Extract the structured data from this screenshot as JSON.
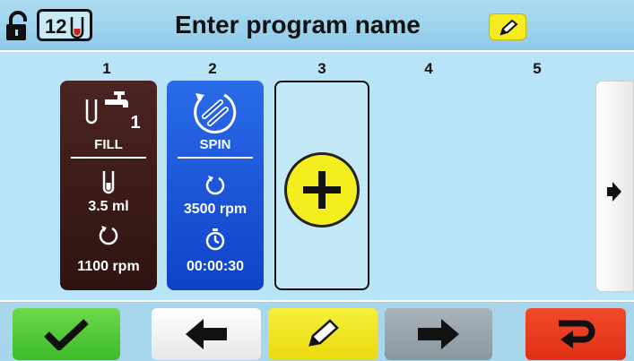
{
  "header": {
    "title": "Enter program name",
    "tube_count": "12"
  },
  "steps": {
    "numbers": [
      "1",
      "2",
      "3",
      "4",
      "5"
    ],
    "fill": {
      "station": "1",
      "label": "FILL",
      "volume": "3.5 ml",
      "speed": "1100 rpm"
    },
    "spin": {
      "label": "SPIN",
      "speed": "3500 rpm",
      "time": "00:00:30"
    }
  },
  "colors": {
    "fill_card": "#3a1a17",
    "spin_card": "#1a55d8",
    "confirm": "#4cc635",
    "edit": "#f2e428",
    "exit": "#e8391b",
    "background": "#b9e3f6"
  },
  "icons": {
    "lock": "lock-open-icon",
    "tube": "test-tube-icon",
    "faucet": "faucet-icon",
    "spin": "centrifuge-spin-icon",
    "speed": "rotation-icon",
    "timer": "stopwatch-icon",
    "add": "plus-icon",
    "confirm": "checkmark-icon",
    "back": "arrow-left-icon",
    "edit": "pencil-icon",
    "forward": "arrow-right-icon",
    "exit": "return-arrow-icon"
  }
}
